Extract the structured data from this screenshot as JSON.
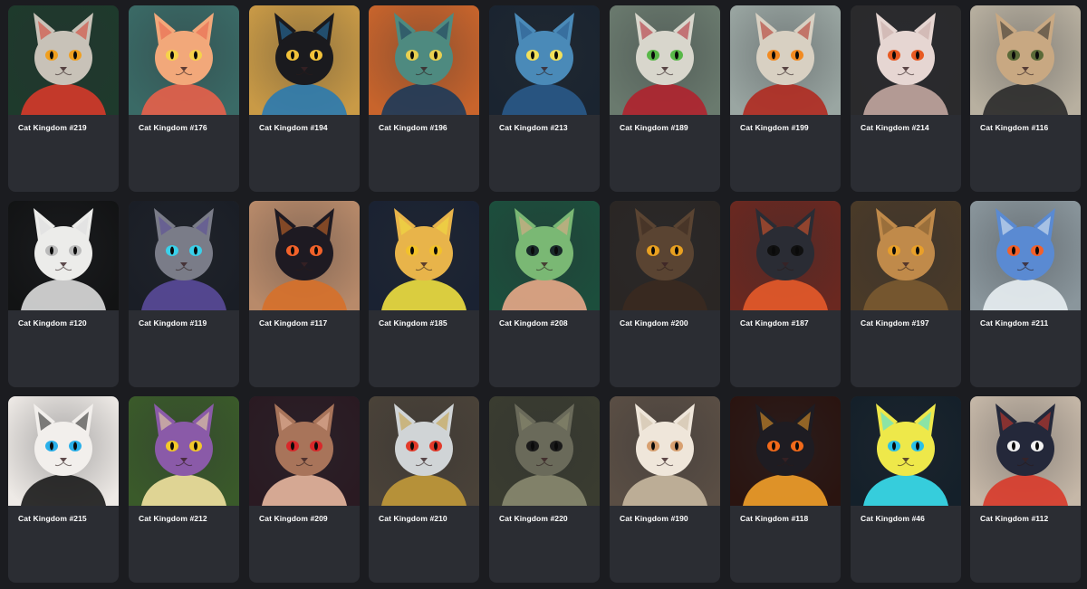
{
  "gallery": {
    "items": [
      {
        "title": "Cat Kingdom #219",
        "bg": "#1e3a2c",
        "fur": "#c8c2b8",
        "eye": "#f0a020",
        "accent": "#d53a2a",
        "icon": "cat-portrait-icon"
      },
      {
        "title": "Cat Kingdom #176",
        "bg": "#3a6a66",
        "fur": "#f2a87a",
        "eye": "#f6d24a",
        "accent": "#e8604a",
        "icon": "cat-portrait-icon"
      },
      {
        "title": "Cat Kingdom #194",
        "bg": "#c99a46",
        "fur": "#1a1a1e",
        "eye": "#f2c23a",
        "accent": "#2a7ab0",
        "icon": "cat-portrait-icon"
      },
      {
        "title": "Cat Kingdom #196",
        "bg": "#c8642c",
        "fur": "#4e8a80",
        "eye": "#e8d050",
        "accent": "#1c3a5a",
        "icon": "cat-portrait-icon"
      },
      {
        "title": "Cat Kingdom #213",
        "bg": "#1a2430",
        "fur": "#4a8ab8",
        "eye": "#f2e05a",
        "accent": "#2a5a8a",
        "icon": "cat-portrait-icon"
      },
      {
        "title": "Cat Kingdom #189",
        "bg": "#6a7a6e",
        "fur": "#d8d6cc",
        "eye": "#58b848",
        "accent": "#b0222e",
        "icon": "cat-portrait-icon"
      },
      {
        "title": "Cat Kingdom #199",
        "bg": "#9aa6a2",
        "fur": "#d8d0c2",
        "eye": "#f28a20",
        "accent": "#b02a20",
        "icon": "cat-portrait-icon"
      },
      {
        "title": "Cat Kingdom #214",
        "bg": "#2a2a2c",
        "fur": "#e6d6d2",
        "eye": "#e85a22",
        "accent": "#c2a6a0",
        "icon": "cat-portrait-icon"
      },
      {
        "title": "Cat Kingdom #116",
        "bg": "#b8b0a0",
        "fur": "#c8a882",
        "eye": "#5a6a38",
        "accent": "#2a2a2a",
        "icon": "cat-portrait-icon"
      },
      {
        "title": "Cat Kingdom #120",
        "bg": "#121314",
        "fur": "#ececea",
        "eye": "#bbbbbb",
        "accent": "#dcdcdc",
        "icon": "cat-portrait-icon"
      },
      {
        "title": "Cat Kingdom #119",
        "bg": "#1a1e26",
        "fur": "#7a7c88",
        "eye": "#3ad0ea",
        "accent": "#5a4a9a",
        "icon": "cat-portrait-icon"
      },
      {
        "title": "Cat Kingdom #117",
        "bg": "#b88a6a",
        "fur": "#1e1a22",
        "eye": "#f2622a",
        "accent": "#d6702a",
        "icon": "cat-portrait-icon"
      },
      {
        "title": "Cat Kingdom #185",
        "bg": "#1a2232",
        "fur": "#e8b44a",
        "eye": "#f2c22a",
        "accent": "#f0e040",
        "icon": "cat-portrait-icon"
      },
      {
        "title": "Cat Kingdom #208",
        "bg": "#1c4e3c",
        "fur": "#7ab874",
        "eye": "#1a2a2a",
        "accent": "#e8a888",
        "icon": "cat-portrait-icon"
      },
      {
        "title": "Cat Kingdom #200",
        "bg": "#2a2624",
        "fur": "#5a4432",
        "eye": "#e8a020",
        "accent": "#3a2a20",
        "icon": "cat-portrait-icon"
      },
      {
        "title": "Cat Kingdom #187",
        "bg": "#6a2820",
        "fur": "#2a2c34",
        "eye": "#101010",
        "accent": "#e65a2a",
        "icon": "cat-portrait-icon"
      },
      {
        "title": "Cat Kingdom #197",
        "bg": "#4a3a28",
        "fur": "#c08a4a",
        "eye": "#e8a02a",
        "accent": "#7a5a30",
        "icon": "cat-portrait-icon"
      },
      {
        "title": "Cat Kingdom #211",
        "bg": "#8a969c",
        "fur": "#5a8ad2",
        "eye": "#f2602a",
        "accent": "#e8eef2",
        "icon": "cat-portrait-icon"
      },
      {
        "title": "Cat Kingdom #215",
        "bg": "#eeeae6",
        "fur": "#f2efec",
        "eye": "#2ab0ea",
        "accent": "#1a1a1a",
        "icon": "cat-portrait-icon"
      },
      {
        "title": "Cat Kingdom #212",
        "bg": "#3a5a2a",
        "fur": "#8a5aa8",
        "eye": "#f2c82a",
        "accent": "#f2e2a0",
        "icon": "cat-portrait-icon"
      },
      {
        "title": "Cat Kingdom #209",
        "bg": "#2a1a22",
        "fur": "#a8745a",
        "eye": "#d8282a",
        "accent": "#e8b8a0",
        "icon": "cat-portrait-icon"
      },
      {
        "title": "Cat Kingdom #210",
        "bg": "#4a4238",
        "fur": "#d0d4d6",
        "eye": "#e23a2a",
        "accent": "#c29a3a",
        "icon": "cat-portrait-icon"
      },
      {
        "title": "Cat Kingdom #220",
        "bg": "#3a3c30",
        "fur": "#6a6a5a",
        "eye": "#1a1a1a",
        "accent": "#8a8a70",
        "icon": "cat-portrait-icon"
      },
      {
        "title": "Cat Kingdom #190",
        "bg": "#5a4e44",
        "fur": "#efe6da",
        "eye": "#d8a070",
        "accent": "#c8b8a0",
        "icon": "cat-portrait-icon"
      },
      {
        "title": "Cat Kingdom #118",
        "bg": "#2a1410",
        "fur": "#1e1c22",
        "eye": "#f26a1a",
        "accent": "#f2a02a",
        "icon": "cat-portrait-icon"
      },
      {
        "title": "Cat Kingdom #46",
        "bg": "#14202a",
        "fur": "#eee84a",
        "eye": "#2ac0e8",
        "accent": "#3ae0f0",
        "icon": "cat-portrait-icon"
      },
      {
        "title": "Cat Kingdom #112",
        "bg": "#c6b8a8",
        "fur": "#24283a",
        "eye": "#f2f2f2",
        "accent": "#d83a2a",
        "icon": "cat-portrait-icon"
      }
    ]
  }
}
